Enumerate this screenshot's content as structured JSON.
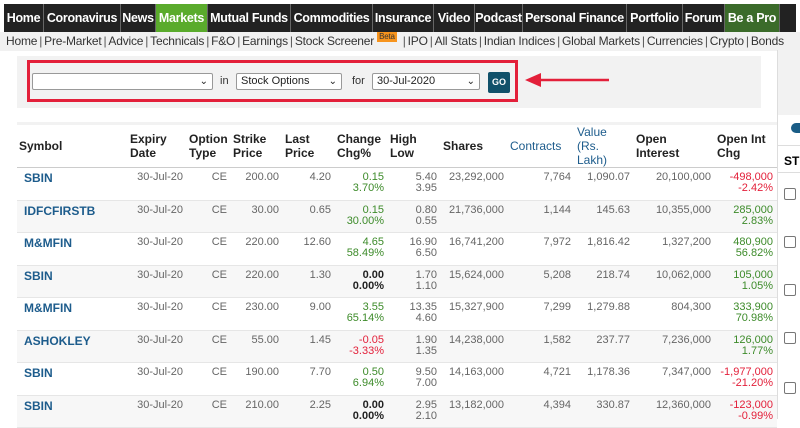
{
  "nav": [
    "Home",
    "Coronavirus",
    "News",
    "Markets",
    "Mutual Funds",
    "Commodities",
    "Insurance",
    "Video",
    "Podcast",
    "Personal Finance",
    "Portfolio",
    "Forum",
    "Be a Pro"
  ],
  "subnav": [
    "Home",
    "Pre-Market",
    "Advice",
    "Technicals",
    "F&O",
    "Earnings",
    "Stock Screener",
    "IPO",
    "All Stats",
    "Indian Indices",
    "Global Markets",
    "Currencies",
    "Crypto",
    "Bonds"
  ],
  "beta": "Beta",
  "form": {
    "symbol": "",
    "in_label": "in",
    "instrument": "Stock Options",
    "for_label": "for",
    "date": "30-Jul-2020",
    "go": "GO"
  },
  "right_panel": {
    "header": "ST"
  },
  "table": {
    "headers": [
      [
        "Symbol"
      ],
      [
        "Expiry",
        "Date"
      ],
      [
        "Option",
        "Type"
      ],
      [
        "Strike",
        "Price"
      ],
      [
        "Last",
        "Price"
      ],
      [
        "Change",
        "Chg%"
      ],
      [
        "High",
        "Low"
      ],
      [
        "Shares"
      ],
      [
        "Contracts"
      ],
      [
        "Value",
        "(Rs. Lakh)"
      ],
      [
        "Open Interest"
      ],
      [
        "Open Int",
        "Chg"
      ]
    ],
    "rows": [
      [
        "SBIN",
        "30-Jul-20",
        "CE",
        "200.00",
        "4.20",
        "0.15",
        "3.70%",
        "5.40",
        "3.95",
        "23,292,000",
        "7,764",
        "1,090.07",
        "20,100,000",
        "-498,000",
        "-2.42%"
      ],
      [
        "IDFCFIRSTB",
        "30-Jul-20",
        "CE",
        "30.00",
        "0.65",
        "0.15",
        "30.00%",
        "0.80",
        "0.55",
        "21,736,000",
        "1,144",
        "145.63",
        "10,355,000",
        "285,000",
        "2.83%"
      ],
      [
        "M&MFIN",
        "30-Jul-20",
        "CE",
        "220.00",
        "12.60",
        "4.65",
        "58.49%",
        "16.90",
        "6.50",
        "16,741,200",
        "7,972",
        "1,816.42",
        "1,327,200",
        "480,900",
        "56.82%"
      ],
      [
        "SBIN",
        "30-Jul-20",
        "CE",
        "220.00",
        "1.30",
        "0.00",
        "0.00%",
        "1.70",
        "1.10",
        "15,624,000",
        "5,208",
        "218.74",
        "10,062,000",
        "105,000",
        "1.05%"
      ],
      [
        "M&MFIN",
        "30-Jul-20",
        "CE",
        "230.00",
        "9.00",
        "3.55",
        "65.14%",
        "13.35",
        "4.60",
        "15,327,900",
        "7,299",
        "1,279.88",
        "804,300",
        "333,900",
        "70.98%"
      ],
      [
        "ASHOKLEY",
        "30-Jul-20",
        "CE",
        "55.00",
        "1.45",
        "-0.05",
        "-3.33%",
        "1.90",
        "1.35",
        "14,238,000",
        "1,582",
        "237.77",
        "7,236,000",
        "126,000",
        "1.77%"
      ],
      [
        "SBIN",
        "30-Jul-20",
        "CE",
        "190.00",
        "7.70",
        "0.50",
        "6.94%",
        "9.50",
        "7.00",
        "14,163,000",
        "4,721",
        "1,178.36",
        "7,347,000",
        "-1,977,000",
        "-21.20%"
      ],
      [
        "SBIN",
        "30-Jul-20",
        "CE",
        "210.00",
        "2.25",
        "0.00",
        "0.00%",
        "2.95",
        "2.10",
        "13,182,000",
        "4,394",
        "330.87",
        "12,360,000",
        "-123,000",
        "-0.99%"
      ]
    ]
  }
}
